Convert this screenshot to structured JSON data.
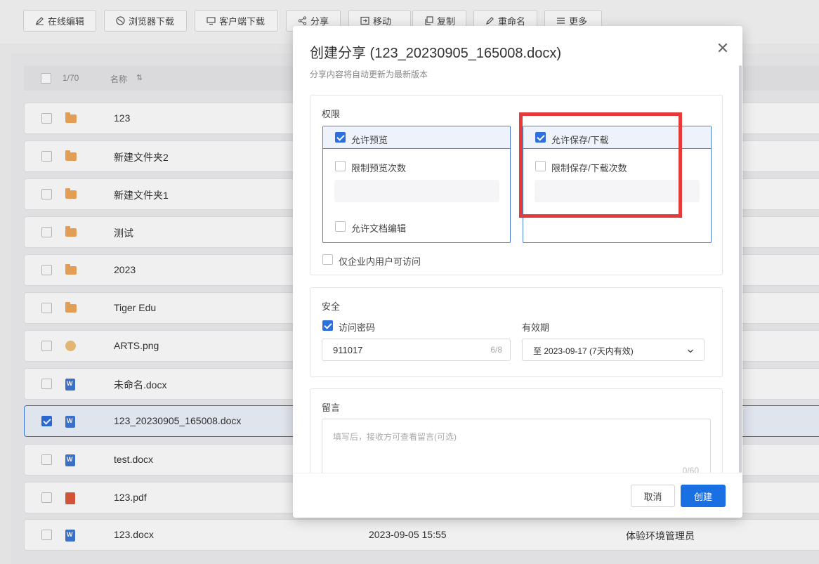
{
  "toolbar": {
    "buttons": [
      {
        "label": "在线编辑",
        "icon": "edit-icon"
      },
      {
        "label": "浏览器下载",
        "icon": "browser-icon"
      },
      {
        "label": "客户端下载",
        "icon": "monitor-icon"
      },
      {
        "label": "分享",
        "icon": "share-icon"
      },
      {
        "label": "移动",
        "icon": "move-icon"
      },
      {
        "label": "复制",
        "icon": "copy-icon"
      },
      {
        "label": "重命名",
        "icon": "rename-icon"
      },
      {
        "label": "更多",
        "icon": "list-icon"
      }
    ]
  },
  "list": {
    "count": "1/70",
    "name_header": "名称",
    "sort_icon": "sort-icon",
    "rows": [
      {
        "name": "123",
        "type": "folder",
        "checked": false,
        "time": "",
        "owner": ""
      },
      {
        "name": "新建文件夹2",
        "type": "folder",
        "checked": false,
        "time": "",
        "owner": ""
      },
      {
        "name": "新建文件夹1",
        "type": "folder",
        "checked": false,
        "time": "",
        "owner": ""
      },
      {
        "name": "测试",
        "type": "folder",
        "checked": false,
        "time": "",
        "owner": ""
      },
      {
        "name": "2023",
        "type": "folder",
        "checked": false,
        "time": "",
        "owner": ""
      },
      {
        "name": "Tiger Edu",
        "type": "folder",
        "checked": false,
        "time": "",
        "owner": ""
      },
      {
        "name": "ARTS.png",
        "type": "img",
        "checked": false,
        "time": "",
        "owner": ""
      },
      {
        "name": "未命名.docx",
        "type": "word",
        "checked": false,
        "time": "",
        "owner": ""
      },
      {
        "name": "123_20230905_165008.docx",
        "type": "word",
        "checked": true,
        "time": "",
        "owner": ""
      },
      {
        "name": "test.docx",
        "type": "word",
        "checked": false,
        "time": "",
        "owner": ""
      },
      {
        "name": "123.pdf",
        "type": "pdf",
        "checked": false,
        "time": "",
        "owner": ""
      },
      {
        "name": "123.docx",
        "type": "word",
        "checked": false,
        "time": "2023-09-05 15:55",
        "owner": "体验环境管理员"
      }
    ]
  },
  "modal": {
    "title": "创建分享 (123_20230905_165008.docx)",
    "subtitle": "分享内容将自动更新为最新版本",
    "close_icon": "close-icon",
    "permissions": {
      "title": "权限",
      "allow_preview": "允许预览",
      "limit_preview_count": "限制预览次数",
      "allow_doc_edit": "允许文档编辑",
      "allow_save_download": "允许保存/下载",
      "limit_save_download_count": "限制保存/下载次数",
      "enterprise_only": "仅企业内用户可访问"
    },
    "security": {
      "title": "安全",
      "access_password_label": "访问密码",
      "password_value": "911017",
      "password_counter": "6/8",
      "validity_label": "有效期",
      "validity_value": "至 2023-09-17 (7天内有效)"
    },
    "message": {
      "title": "留言",
      "placeholder": "填写后，接收方可查看留言(可选)",
      "counter": "0/60"
    },
    "cancel_label": "取消",
    "create_label": "创建",
    "accent_color": "#1a6fe3",
    "highlight_color": "#e53a3a"
  }
}
